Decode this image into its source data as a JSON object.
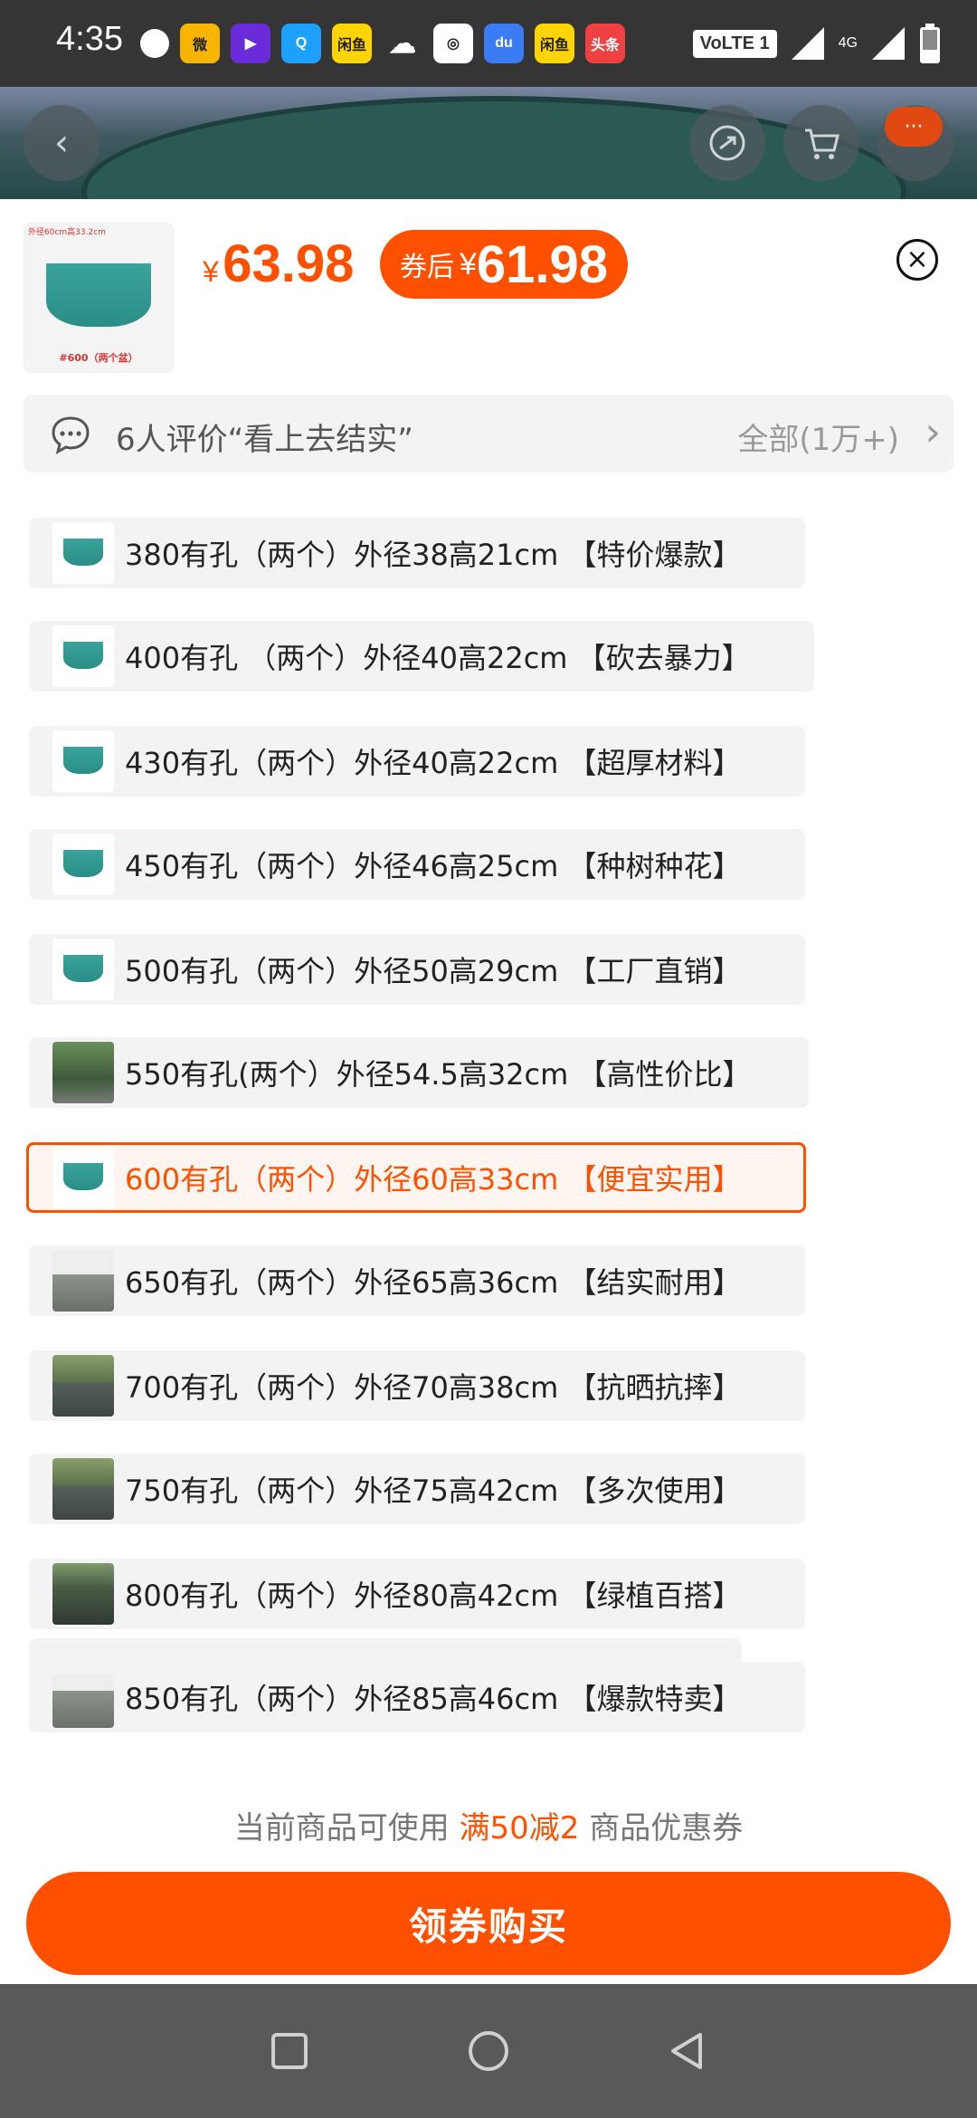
{
  "status_bar": {
    "time": "4:35",
    "app_icons": [
      {
        "name": "message-icon",
        "text": "",
        "color": "#ffffff"
      },
      {
        "name": "weibo-icon",
        "text": "微",
        "color": "#f7b500"
      },
      {
        "name": "video-app-icon",
        "text": "▶",
        "color": "#6a2bd9"
      },
      {
        "name": "qq-icon",
        "text": "Q",
        "color": "#1ea0ff"
      },
      {
        "name": "xianyu-icon",
        "text": "闲鱼",
        "color": "#ffd400"
      },
      {
        "name": "cloud-icon",
        "text": "☁",
        "color": "#353535"
      },
      {
        "name": "browser-icon",
        "text": "◎",
        "color": "#ffffff"
      },
      {
        "name": "baidu-icon",
        "text": "du",
        "color": "#3b7cf5"
      },
      {
        "name": "xianyu-icon-2",
        "text": "闲鱼",
        "color": "#ffd400"
      },
      {
        "name": "toutiao-icon",
        "text": "头条",
        "color": "#f04142"
      }
    ],
    "network_badge": "VoLTE 1",
    "network_type": "4G"
  },
  "header": {
    "back_icon": "chevron-left-icon",
    "share_icon": "share-icon",
    "cart_icon": "cart-icon",
    "more_icon": "more-icon",
    "more_label": "···"
  },
  "sku_panel": {
    "main_thumb_caption_top": "外径60cm高33.2cm",
    "main_thumb_caption_bottom": "#600（两个盆）",
    "price_currency": "¥",
    "price": "63.98",
    "coupon_label": "券后",
    "coupon_currency": "¥",
    "coupon_price": "61.98",
    "close_icon": "close-icon",
    "review": {
      "text": "6人评价“看上去结实”",
      "all_label": "全部(1万+)",
      "chevron": "›"
    },
    "options": [
      {
        "label": "380有孔（两个）外径38高21cm 【特价爆款】",
        "thumb": "teal"
      },
      {
        "label": "400有孔 （两个）外径40高22cm 【砍去暴力】",
        "thumb": "teal"
      },
      {
        "label": "430有孔（两个）外径40高22cm 【超厚材料】",
        "thumb": "teal"
      },
      {
        "label": "450有孔（两个）外径46高25cm 【种树种花】",
        "thumb": "teal"
      },
      {
        "label": "500有孔（两个）外径50高29cm 【工厂直销】",
        "thumb": "teal"
      },
      {
        "label": "550有孔(两个）外径54.5高32cm 【高性价比】",
        "thumb": "photo"
      },
      {
        "label": "600有孔（两个）外径60高33cm 【便宜实用】",
        "thumb": "teal",
        "selected": true
      },
      {
        "label": "650有孔（两个）外径65高36cm 【结实耐用】",
        "thumb": "grey"
      },
      {
        "label": "700有孔（两个）外径70高38cm 【抗晒抗摔】",
        "thumb": "garden"
      },
      {
        "label": "750有孔（两个）外径75高42cm 【多次使用】",
        "thumb": "garden"
      },
      {
        "label": "800有孔（两个）外径80高42cm 【绿植百搭】",
        "thumb": "dark"
      },
      {
        "label": "850有孔（两个）外径85高46cm 【爆款特卖】",
        "thumb": "grey"
      }
    ],
    "partial_option_label": ""
  },
  "footer": {
    "coupon_note_prefix": "当前商品可使用 ",
    "coupon_note_highlight": "满50减2",
    "coupon_note_suffix": " 商品优惠券",
    "buy_button": "领券购买"
  },
  "nav_bar": {
    "recent_icon": "square-icon",
    "home_icon": "circle-icon",
    "back_icon": "triangle-back-icon"
  },
  "colors": {
    "accent": "#ff5000",
    "status_bar": "#353535",
    "nav_bar": "#595959"
  }
}
